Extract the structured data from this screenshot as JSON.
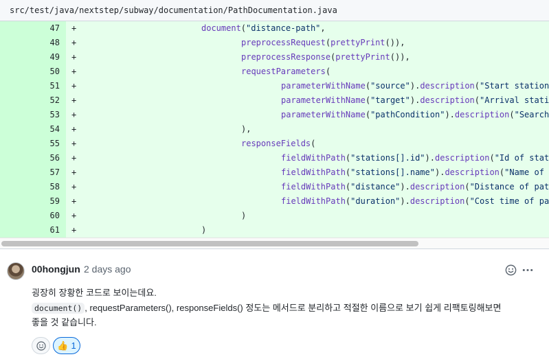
{
  "file": {
    "path": "src/test/java/nextstep/subway/documentation/PathDocumentation.java"
  },
  "diff": {
    "marker": "+",
    "lines": [
      {
        "num": "47",
        "indent": 0,
        "tokens": [
          [
            "fn",
            "document"
          ],
          [
            "p",
            "("
          ],
          [
            "str",
            "\"distance-path\""
          ],
          [
            "p",
            ","
          ]
        ]
      },
      {
        "num": "48",
        "indent": 1,
        "tokens": [
          [
            "fn",
            "preprocessRequest"
          ],
          [
            "p",
            "("
          ],
          [
            "fn",
            "prettyPrint"
          ],
          [
            "p",
            "()),"
          ]
        ]
      },
      {
        "num": "49",
        "indent": 1,
        "tokens": [
          [
            "fn",
            "preprocessResponse"
          ],
          [
            "p",
            "("
          ],
          [
            "fn",
            "prettyPrint"
          ],
          [
            "p",
            "()),"
          ]
        ]
      },
      {
        "num": "50",
        "indent": 1,
        "tokens": [
          [
            "fn",
            "requestParameters"
          ],
          [
            "p",
            "("
          ]
        ]
      },
      {
        "num": "51",
        "indent": 2,
        "tokens": [
          [
            "fn",
            "parameterWithName"
          ],
          [
            "p",
            "("
          ],
          [
            "str",
            "\"source\""
          ],
          [
            "p",
            ")."
          ],
          [
            "fn",
            "description"
          ],
          [
            "p",
            "("
          ],
          [
            "str",
            "\"Start station"
          ]
        ]
      },
      {
        "num": "52",
        "indent": 2,
        "tokens": [
          [
            "fn",
            "parameterWithName"
          ],
          [
            "p",
            "("
          ],
          [
            "str",
            "\"target\""
          ],
          [
            "p",
            ")."
          ],
          [
            "fn",
            "description"
          ],
          [
            "p",
            "("
          ],
          [
            "str",
            "\"Arrival stati"
          ]
        ]
      },
      {
        "num": "53",
        "indent": 2,
        "tokens": [
          [
            "fn",
            "parameterWithName"
          ],
          [
            "p",
            "("
          ],
          [
            "str",
            "\"pathCondition\""
          ],
          [
            "p",
            ")."
          ],
          [
            "fn",
            "description"
          ],
          [
            "p",
            "("
          ],
          [
            "str",
            "\"Search"
          ]
        ]
      },
      {
        "num": "54",
        "indent": 1,
        "tokens": [
          [
            "p",
            "),"
          ]
        ]
      },
      {
        "num": "55",
        "indent": 1,
        "tokens": [
          [
            "fn",
            "responseFields"
          ],
          [
            "p",
            "("
          ]
        ]
      },
      {
        "num": "56",
        "indent": 2,
        "tokens": [
          [
            "fn",
            "fieldWithPath"
          ],
          [
            "p",
            "("
          ],
          [
            "str",
            "\"stations[].id\""
          ],
          [
            "p",
            ")."
          ],
          [
            "fn",
            "description"
          ],
          [
            "p",
            "("
          ],
          [
            "str",
            "\"Id of stat"
          ]
        ]
      },
      {
        "num": "57",
        "indent": 2,
        "tokens": [
          [
            "fn",
            "fieldWithPath"
          ],
          [
            "p",
            "("
          ],
          [
            "str",
            "\"stations[].name\""
          ],
          [
            "p",
            ")."
          ],
          [
            "fn",
            "description"
          ],
          [
            "p",
            "("
          ],
          [
            "str",
            "\"Name of"
          ]
        ]
      },
      {
        "num": "58",
        "indent": 2,
        "tokens": [
          [
            "fn",
            "fieldWithPath"
          ],
          [
            "p",
            "("
          ],
          [
            "str",
            "\"distance\""
          ],
          [
            "p",
            ")."
          ],
          [
            "fn",
            "description"
          ],
          [
            "p",
            "("
          ],
          [
            "str",
            "\"Distance of pat"
          ]
        ]
      },
      {
        "num": "59",
        "indent": 2,
        "tokens": [
          [
            "fn",
            "fieldWithPath"
          ],
          [
            "p",
            "("
          ],
          [
            "str",
            "\"duration\""
          ],
          [
            "p",
            ")."
          ],
          [
            "fn",
            "description"
          ],
          [
            "p",
            "("
          ],
          [
            "str",
            "\"Cost time of pa"
          ]
        ]
      },
      {
        "num": "60",
        "indent": 1,
        "tokens": [
          [
            "p",
            ")"
          ]
        ]
      },
      {
        "num": "61",
        "indent": 0,
        "tokens": [
          [
            "p",
            ")"
          ]
        ]
      }
    ]
  },
  "comment": {
    "author": "00hongjun",
    "time": "2 days ago",
    "line1": "굉장히 장황한 코드로 보이는데요.",
    "code_ref": "document()",
    "line2_rest": ", requestParameters(), responseFields() 정도는 메서드로 분리하고 적절한 이름으로 보기 쉽게 리팩토링해보면",
    "line3": "좋을 것 같습니다.",
    "reaction": {
      "emoji": "👍",
      "count": "1"
    },
    "icons": {
      "react": "smiley-icon",
      "more": "kebab-horizontal-icon"
    }
  },
  "colors": {
    "addition_bg": "#e6ffec",
    "addition_gutter": "#ccffd8",
    "function": "#6639ba",
    "string": "#0a3069",
    "reaction_accent": "#0969da"
  }
}
